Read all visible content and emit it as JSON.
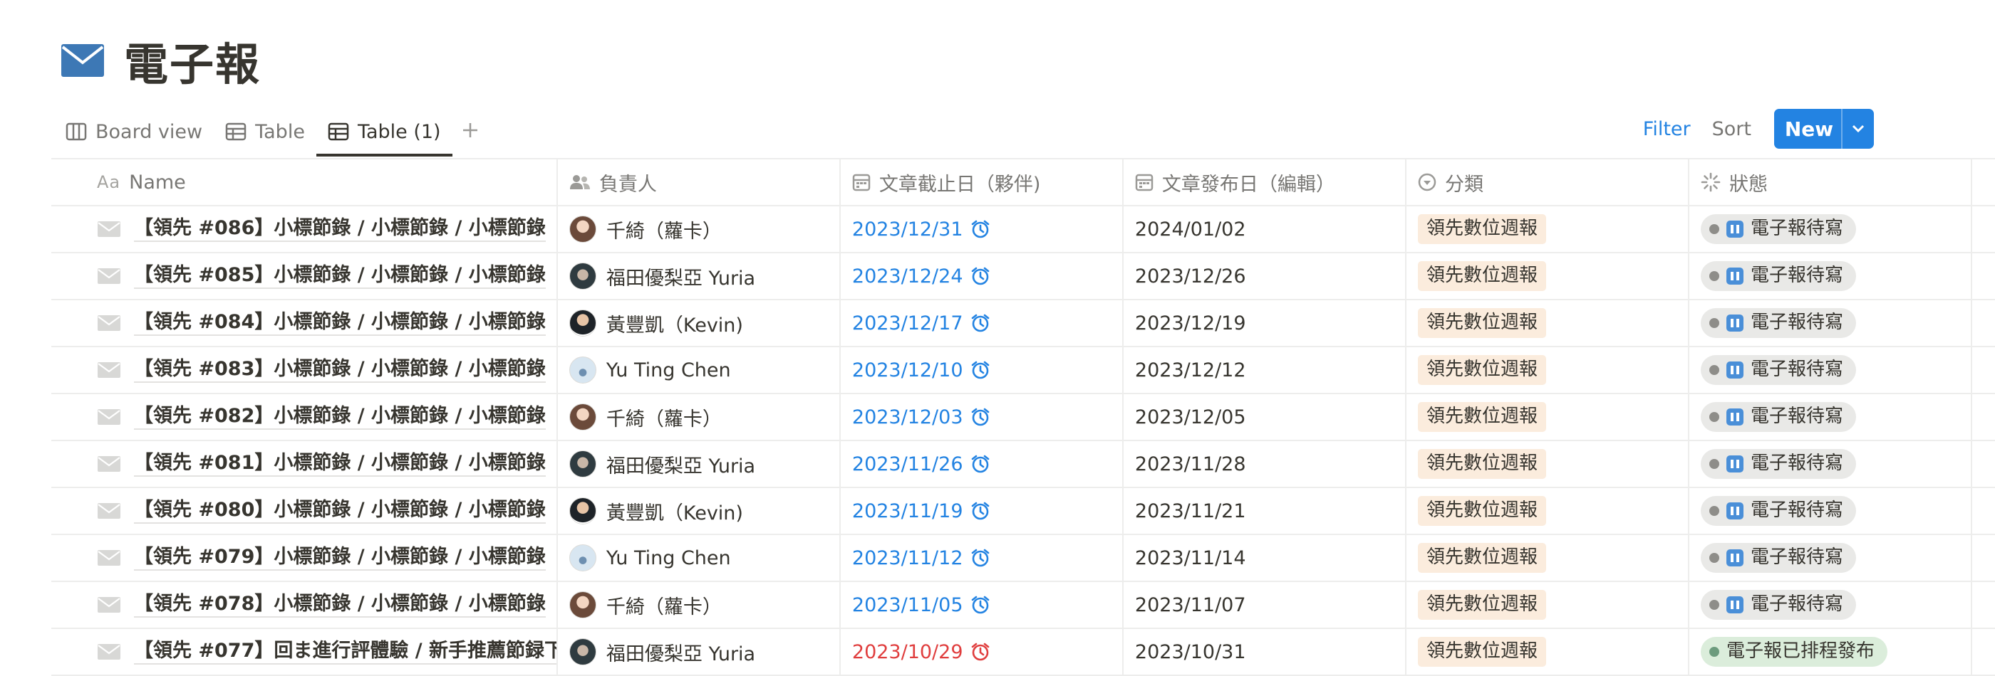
{
  "page": {
    "title": "電子報",
    "icon": "envelope-icon"
  },
  "views": [
    {
      "label": "Board view",
      "icon": "board-icon",
      "active": false
    },
    {
      "label": "Table",
      "icon": "table-icon",
      "active": false
    },
    {
      "label": "Table (1)",
      "icon": "table-icon",
      "active": true
    }
  ],
  "toolbar": {
    "filter_label": "Filter",
    "sort_label": "Sort",
    "automation_icon": "lightning-icon",
    "search_icon": "search-icon",
    "more_icon": "more-horizontal-icon",
    "new_label": "New",
    "accent_color": "#2383e2"
  },
  "columns": {
    "name": {
      "prefix": "Aa",
      "label": "Name"
    },
    "owner": {
      "label": "負責人",
      "icon": "people-icon"
    },
    "due": {
      "label": "文章截止日（夥伴)",
      "icon": "calendar-icon"
    },
    "publish": {
      "label": "文章發布日（編輯）",
      "icon": "calendar-icon"
    },
    "category": {
      "label": "分類",
      "icon": "select-icon"
    },
    "status": {
      "label": "狀態",
      "icon": "status-loading-icon"
    }
  },
  "rows": [
    {
      "name": "【領先 #086】小標節錄 / 小標節錄 / 小標節錄",
      "owner": "千綺（蘿卡）",
      "avatar": "qi",
      "due": "2023/12/31",
      "publish": "2024/01/02",
      "category": "領先數位週報",
      "status": "電子報待寫"
    },
    {
      "name": "【領先 #085】小標節錄 / 小標節錄 / 小標節錄",
      "owner": "福田優梨亞 Yuria",
      "avatar": "yuria",
      "due": "2023/12/24",
      "publish": "2023/12/26",
      "category": "領先數位週報",
      "status": "電子報待寫"
    },
    {
      "name": "【領先 #084】小標節錄 / 小標節錄 / 小標節錄",
      "owner": "黃豐凱（Kevin)",
      "avatar": "kevin",
      "due": "2023/12/17",
      "publish": "2023/12/19",
      "category": "領先數位週報",
      "status": "電子報待寫"
    },
    {
      "name": "【領先 #083】小標節錄 / 小標節錄 / 小標節錄",
      "owner": "Yu Ting Chen",
      "avatar": "yuting",
      "due": "2023/12/10",
      "publish": "2023/12/12",
      "category": "領先數位週報",
      "status": "電子報待寫"
    },
    {
      "name": "【領先 #082】小標節錄 / 小標節錄 / 小標節錄",
      "owner": "千綺（蘿卡）",
      "avatar": "qi",
      "due": "2023/12/03",
      "publish": "2023/12/05",
      "category": "領先數位週報",
      "status": "電子報待寫"
    },
    {
      "name": "【領先 #081】小標節錄 / 小標節錄 / 小標節錄",
      "owner": "福田優梨亞 Yuria",
      "avatar": "yuria",
      "due": "2023/11/26",
      "publish": "2023/11/28",
      "category": "領先數位週報",
      "status": "電子報待寫"
    },
    {
      "name": "【領先 #080】小標節錄 / 小標節錄 / 小標節錄",
      "owner": "黃豐凱（Kevin)",
      "avatar": "kevin",
      "due": "2023/11/19",
      "publish": "2023/11/21",
      "category": "領先數位週報",
      "status": "電子報待寫"
    },
    {
      "name": "【領先 #079】小標節錄 / 小標節錄 / 小標節錄",
      "owner": "Yu Ting Chen",
      "avatar": "yuting",
      "due": "2023/11/12",
      "publish": "2023/11/14",
      "category": "領先數位週報",
      "status": "電子報待寫"
    },
    {
      "name": "【領先 #078】小標節錄 / 小標節錄 / 小標節錄",
      "owner": "千綺（蘿卡）",
      "avatar": "qi",
      "due": "2023/11/05",
      "publish": "2023/11/07",
      "category": "領先數位週報",
      "status": "電子報待寫"
    },
    {
      "name": "【領先 #077】回ま進行評體驗 / 新手推薦節録下",
      "owner": "福田優梨亞 Yuria",
      "avatar": "yuria",
      "due": "2023/10/29",
      "publish": "2023/10/31",
      "category": "領先數位週報",
      "status": "電子報已排程發布",
      "overdue": true,
      "published": true
    }
  ]
}
